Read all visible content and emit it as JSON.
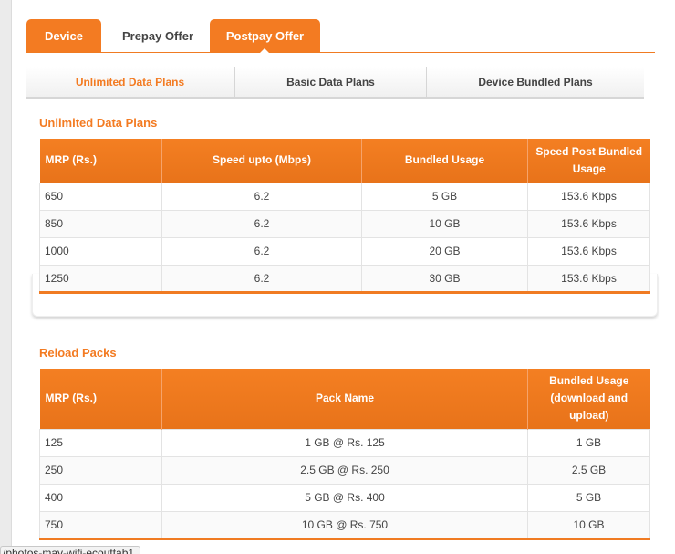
{
  "tabs": [
    {
      "label": "Device",
      "active": false
    },
    {
      "label": "Prepay Offer",
      "active": false
    },
    {
      "label": "Postpay Offer",
      "active": true
    }
  ],
  "subtabs": [
    {
      "label": "Unlimited Data Plans",
      "active": true
    },
    {
      "label": "Basic Data Plans",
      "active": false
    },
    {
      "label": "Device Bundled Plans",
      "active": false
    }
  ],
  "unlimited": {
    "title": "Unlimited Data Plans",
    "headers": [
      "MRP (Rs.)",
      "Speed upto (Mbps)",
      "Bundled Usage",
      "Speed Post Bundled Usage"
    ],
    "rows": [
      [
        "650",
        "6.2",
        "5 GB",
        "153.6 Kbps"
      ],
      [
        "850",
        "6.2",
        "10 GB",
        "153.6 Kbps"
      ],
      [
        "1000",
        "6.2",
        "20 GB",
        "153.6 Kbps"
      ],
      [
        "1250",
        "6.2",
        "30 GB",
        "153.6 Kbps"
      ]
    ]
  },
  "reload": {
    "title": "Reload Packs",
    "headers": [
      "MRP (Rs.)",
      "Pack Name",
      "Bundled Usage (download and upload)"
    ],
    "rows": [
      [
        "125",
        "1 GB @ Rs. 125",
        "1 GB"
      ],
      [
        "250",
        "2.5 GB @ Rs. 250",
        "2.5 GB"
      ],
      [
        "400",
        "5 GB @ Rs. 400",
        "5 GB"
      ],
      [
        "750",
        "10 GB @ Rs. 750",
        "10 GB"
      ]
    ]
  },
  "colors": {
    "accent": "#f37b22"
  },
  "status_bar": {
    "text": "/photos-may-wifi-ecouttab1"
  }
}
